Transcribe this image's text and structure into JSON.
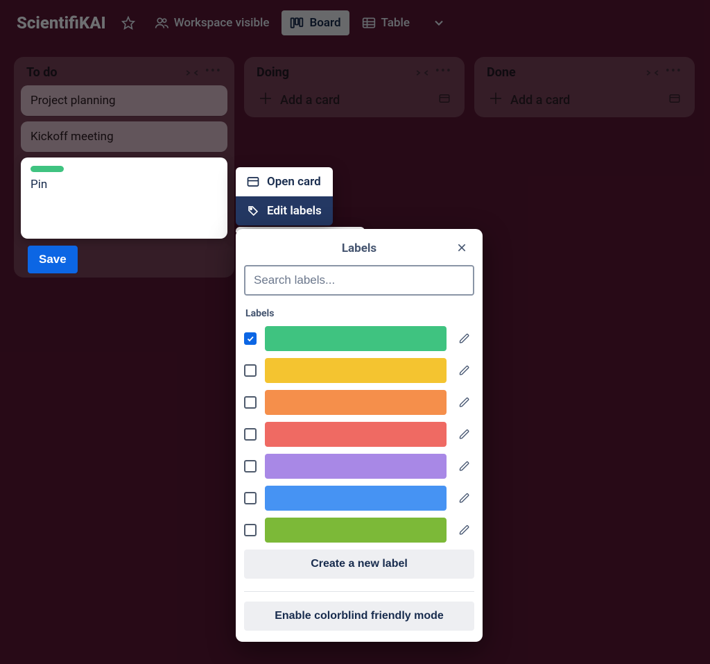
{
  "board": {
    "title": "ScientifiKAI"
  },
  "topbar": {
    "workspace_visible": "Workspace visible",
    "board": "Board",
    "table": "Table"
  },
  "lists": {
    "todo": {
      "title": "To do",
      "add": "Add a card"
    },
    "doing": {
      "title": "Doing",
      "add": "Add a card"
    },
    "done": {
      "title": "Done",
      "add": "Add a card"
    }
  },
  "cards": {
    "todo": [
      "Project planning",
      "Kickoff meeting"
    ]
  },
  "composer": {
    "text": "Pin",
    "save": "Save",
    "label_color": "#3fc380"
  },
  "ctx": {
    "open": "Open card",
    "edit": "Edit labels"
  },
  "labels_popover": {
    "title": "Labels",
    "search_placeholder": "Search labels...",
    "section": "Labels",
    "items": [
      {
        "color": "#3fc380",
        "checked": true
      },
      {
        "color": "#f4c430",
        "checked": false
      },
      {
        "color": "#f58f4b",
        "checked": false
      },
      {
        "color": "#ef6a63",
        "checked": false
      },
      {
        "color": "#a888e6",
        "checked": false
      },
      {
        "color": "#4693f3",
        "checked": false
      },
      {
        "color": "#7cb938",
        "checked": false
      }
    ],
    "create": "Create a new label",
    "colorblind": "Enable colorblind friendly mode"
  }
}
